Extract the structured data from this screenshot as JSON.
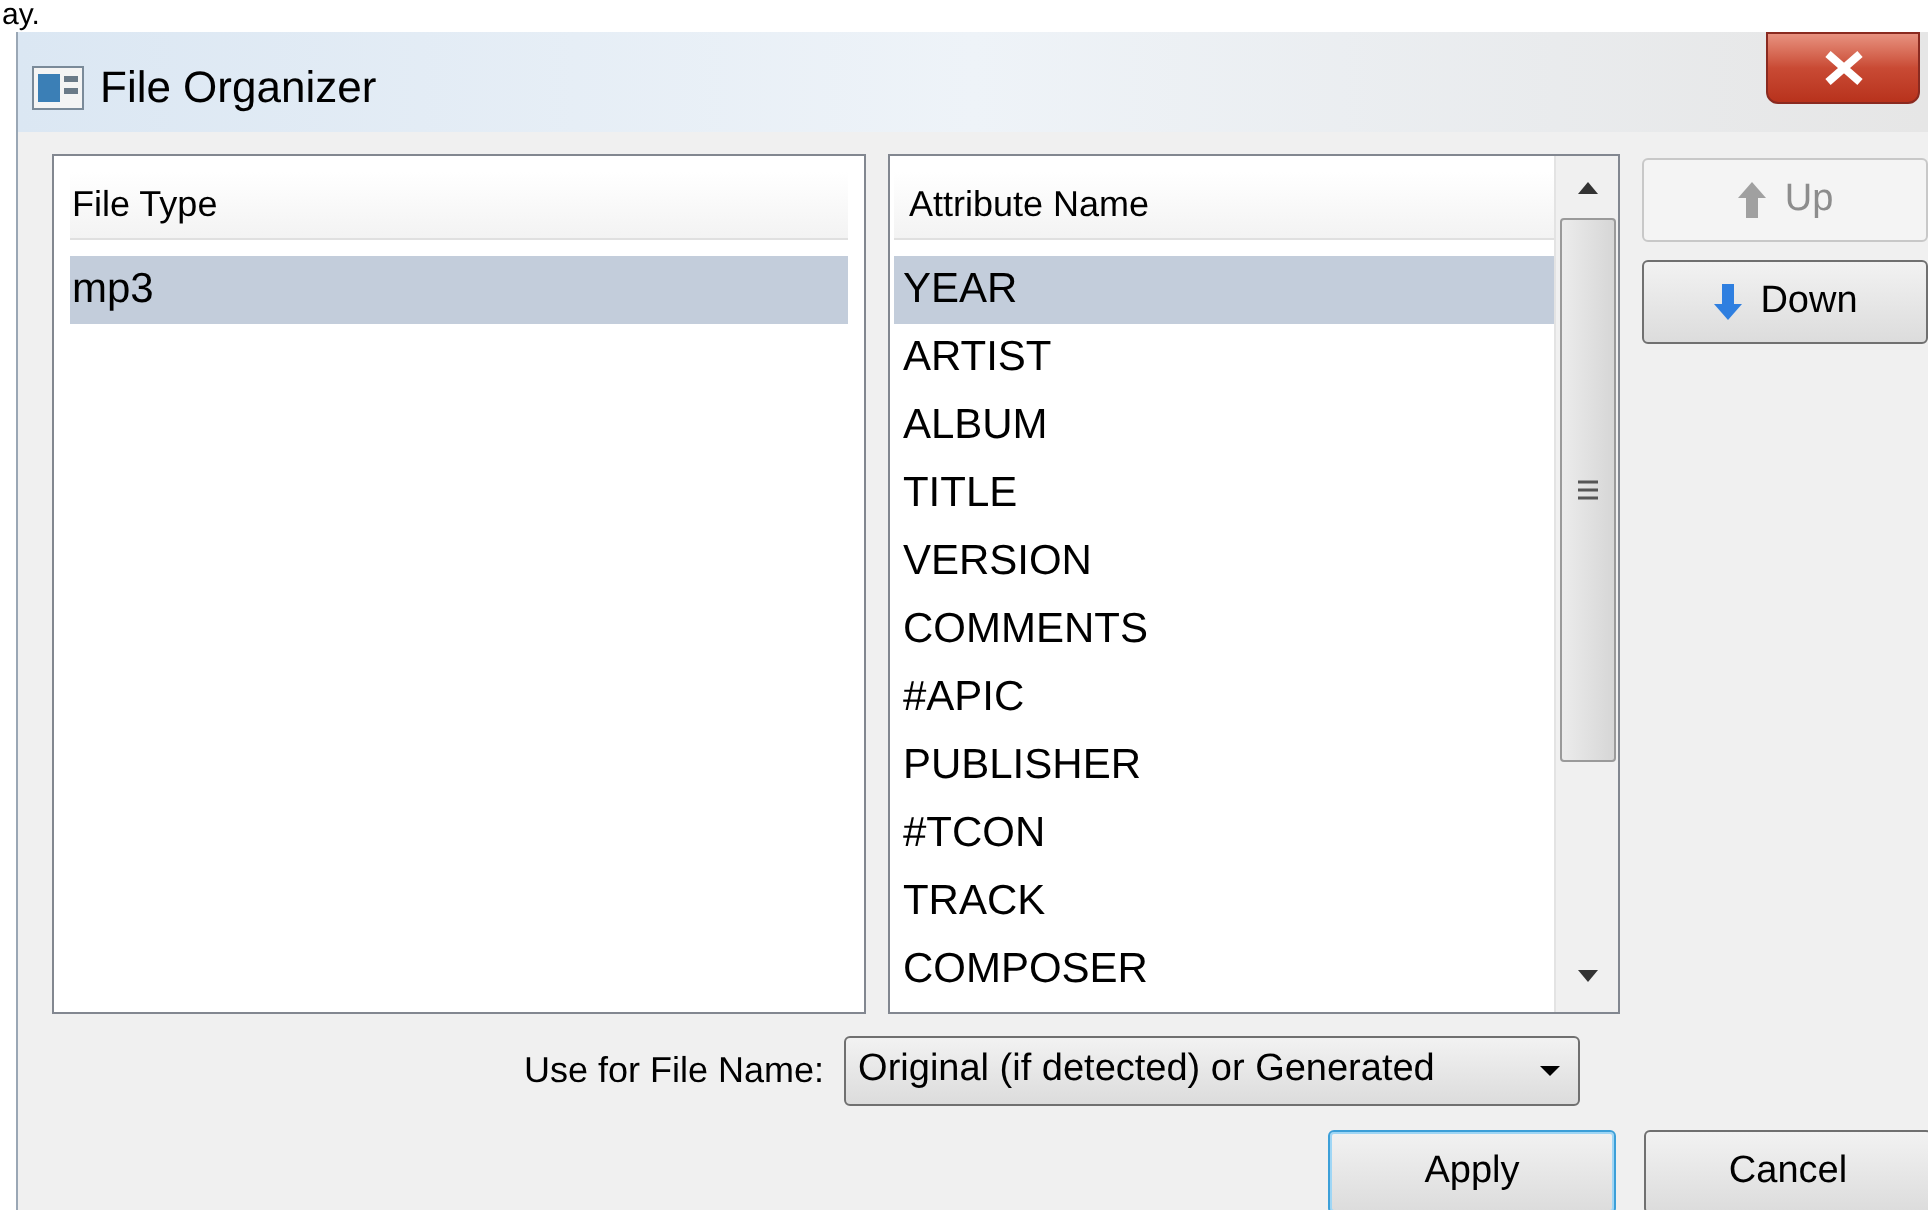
{
  "background_text": "ay.",
  "window": {
    "title": "File Organizer"
  },
  "file_types": {
    "column": "File Type",
    "rows": [
      {
        "label": "mp3",
        "selected": true
      }
    ]
  },
  "attributes": {
    "column": "Attribute Name",
    "rows": [
      {
        "label": "YEAR",
        "selected": true
      },
      {
        "label": "ARTIST",
        "selected": false
      },
      {
        "label": "ALBUM",
        "selected": false
      },
      {
        "label": "TITLE",
        "selected": false
      },
      {
        "label": "VERSION",
        "selected": false
      },
      {
        "label": "COMMENTS",
        "selected": false
      },
      {
        "label": "#APIC",
        "selected": false
      },
      {
        "label": "PUBLISHER",
        "selected": false
      },
      {
        "label": "#TCON",
        "selected": false
      },
      {
        "label": "TRACK",
        "selected": false
      },
      {
        "label": "COMPOSER",
        "selected": false
      }
    ]
  },
  "side_buttons": [
    {
      "label": "Up",
      "kind": "up",
      "disabled": true
    },
    {
      "label": "Down",
      "kind": "down",
      "disabled": false
    }
  ],
  "file_name": {
    "label": "Use for File Name:",
    "value": "Original (if detected) or Generated"
  },
  "buttons": [
    {
      "label": "Apply",
      "default": true
    },
    {
      "label": "Cancel",
      "default": false
    }
  ]
}
